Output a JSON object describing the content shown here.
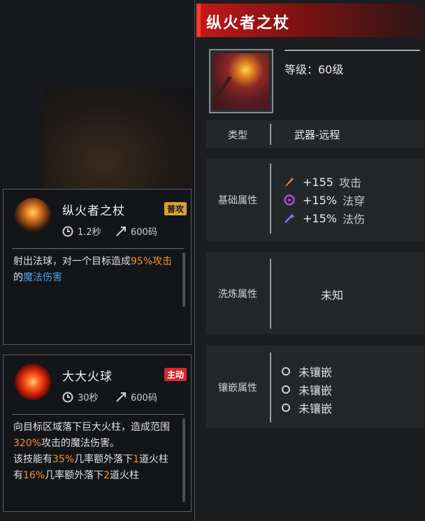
{
  "tooltip": {
    "title": "纵火者之杖",
    "level": "等级：60级",
    "type_label": "类型",
    "type_value": "武器-远程",
    "base_label": "基础属性",
    "base_attrs": [
      {
        "icon": "attack-icon",
        "value": "+155",
        "name": "攻击"
      },
      {
        "icon": "magic-penetration-icon",
        "value": "+15%",
        "name": "法穿"
      },
      {
        "icon": "magic-damage-icon",
        "value": "+15%",
        "name": "法伤"
      }
    ],
    "refine_label": "洗炼属性",
    "refine_value": "未知",
    "socket_label": "镶嵌属性",
    "sockets": [
      "未镶嵌",
      "未镶嵌",
      "未镶嵌"
    ]
  },
  "skills": [
    {
      "name": "纵火者之杖",
      "badge": "普攻",
      "cooldown": "1.2秒",
      "range": "600码",
      "desc_parts": [
        "射出法球，对一个目标造成",
        "95%",
        "攻击",
        "的",
        "魔法伤害"
      ]
    },
    {
      "name": "大大火球",
      "badge": "主动",
      "cooldown": "30秒",
      "range": "600码",
      "desc_a": "向目标区域落下巨大火柱，造成范围",
      "desc_b": "320%",
      "desc_c": "攻击的魔法伤害。",
      "desc_d": "该技能有",
      "desc_e": "35%",
      "desc_f": "几率额外落下",
      "desc_g": "1",
      "desc_h": "道火柱",
      "desc_i": "有",
      "desc_j": "16%",
      "desc_k": "几率额外落下",
      "desc_l": "2",
      "desc_m": "道火柱"
    }
  ],
  "colors": {
    "accent_red": "#c51818",
    "highlight_orange": "#f0963a",
    "highlight_blue": "#4aa0ea"
  }
}
